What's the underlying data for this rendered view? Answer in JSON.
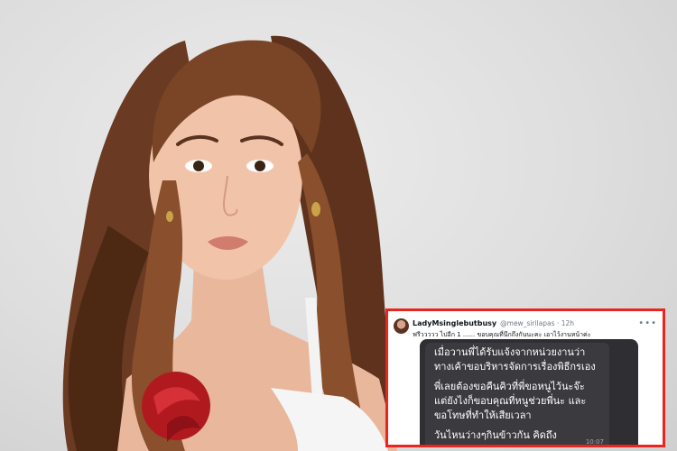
{
  "tweet": {
    "name": "LadyMsinglebutbusy",
    "handle": "@mew_sirilapas · 12h",
    "text": "ฟรีววววว ไปอีก 1 ...... ขอบคุณที่นึกถึงกันนะคะ เอาไว้งานหน้าค่ะ",
    "more_icon": "•••",
    "chat": {
      "lines": [
        "เมื่อวานพี่ได้รับแจ้งจากหน่วยงานว่า",
        "ทางเค้าขอบริหารจัดการเรื่องพิธีกรเอง",
        "พี่เลยต้องขอคืนคิวที่พี่ขอหนูไว้นะจ๊ะ",
        "แต่ยังไงก็ขอบคุณที่หนูช่วยพี่นะ และ",
        "ขอโทษที่ทำให้เสียเวลา",
        "วันไหนว่างๆกินข้าวกัน คิดถึง"
      ],
      "time": "10:07"
    }
  },
  "colors": {
    "highlight_border": "#e8251f",
    "chat_bg": "#2f2f33"
  }
}
